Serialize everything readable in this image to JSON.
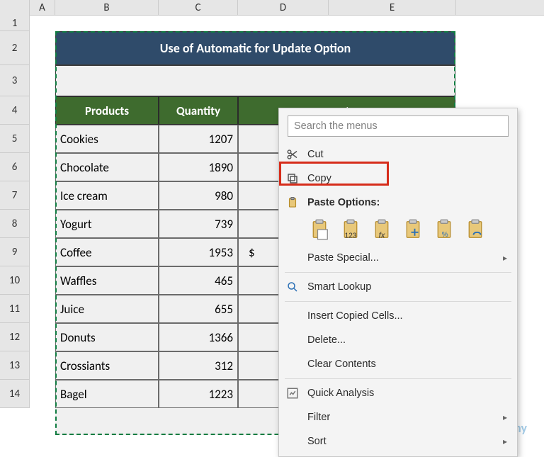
{
  "columns": [
    "A",
    "B",
    "C",
    "D",
    "E"
  ],
  "rows": [
    "1",
    "2",
    "3",
    "4",
    "5",
    "6",
    "7",
    "8",
    "9",
    "10",
    "11",
    "12",
    "13",
    "14"
  ],
  "title": "Use of Automatic for Update Option",
  "headers": {
    "products": "Products",
    "quantity": "Quantity",
    "rest": "$"
  },
  "data": [
    {
      "product": "Cookies",
      "qty": "1207",
      "rest": ""
    },
    {
      "product": "Chocolate",
      "qty": "1890",
      "rest": ""
    },
    {
      "product": "Ice cream",
      "qty": "980",
      "rest": ""
    },
    {
      "product": "Yogurt",
      "qty": "739",
      "rest": ""
    },
    {
      "product": "Coffee",
      "qty": "1953",
      "rest": "$"
    },
    {
      "product": "Waffles",
      "qty": "465",
      "rest": ""
    },
    {
      "product": "Juice",
      "qty": "655",
      "rest": ""
    },
    {
      "product": "Donuts",
      "qty": "1366",
      "rest": ""
    },
    {
      "product": "Crossiants",
      "qty": "312",
      "rest": ""
    },
    {
      "product": "Bagel",
      "qty": "1223",
      "rest": ""
    }
  ],
  "ctx": {
    "search_placeholder": "Search the menus",
    "cut": "Cut",
    "copy": "Copy",
    "paste_options": "Paste Options:",
    "paste_special": "Paste Special...",
    "smart_lookup": "Smart Lookup",
    "insert_copied": "Insert Copied Cells...",
    "delete": "Delete...",
    "clear_contents": "Clear Contents",
    "quick_analysis": "Quick Analysis",
    "filter": "Filter",
    "sort": "Sort"
  },
  "watermark": "exceldemy"
}
